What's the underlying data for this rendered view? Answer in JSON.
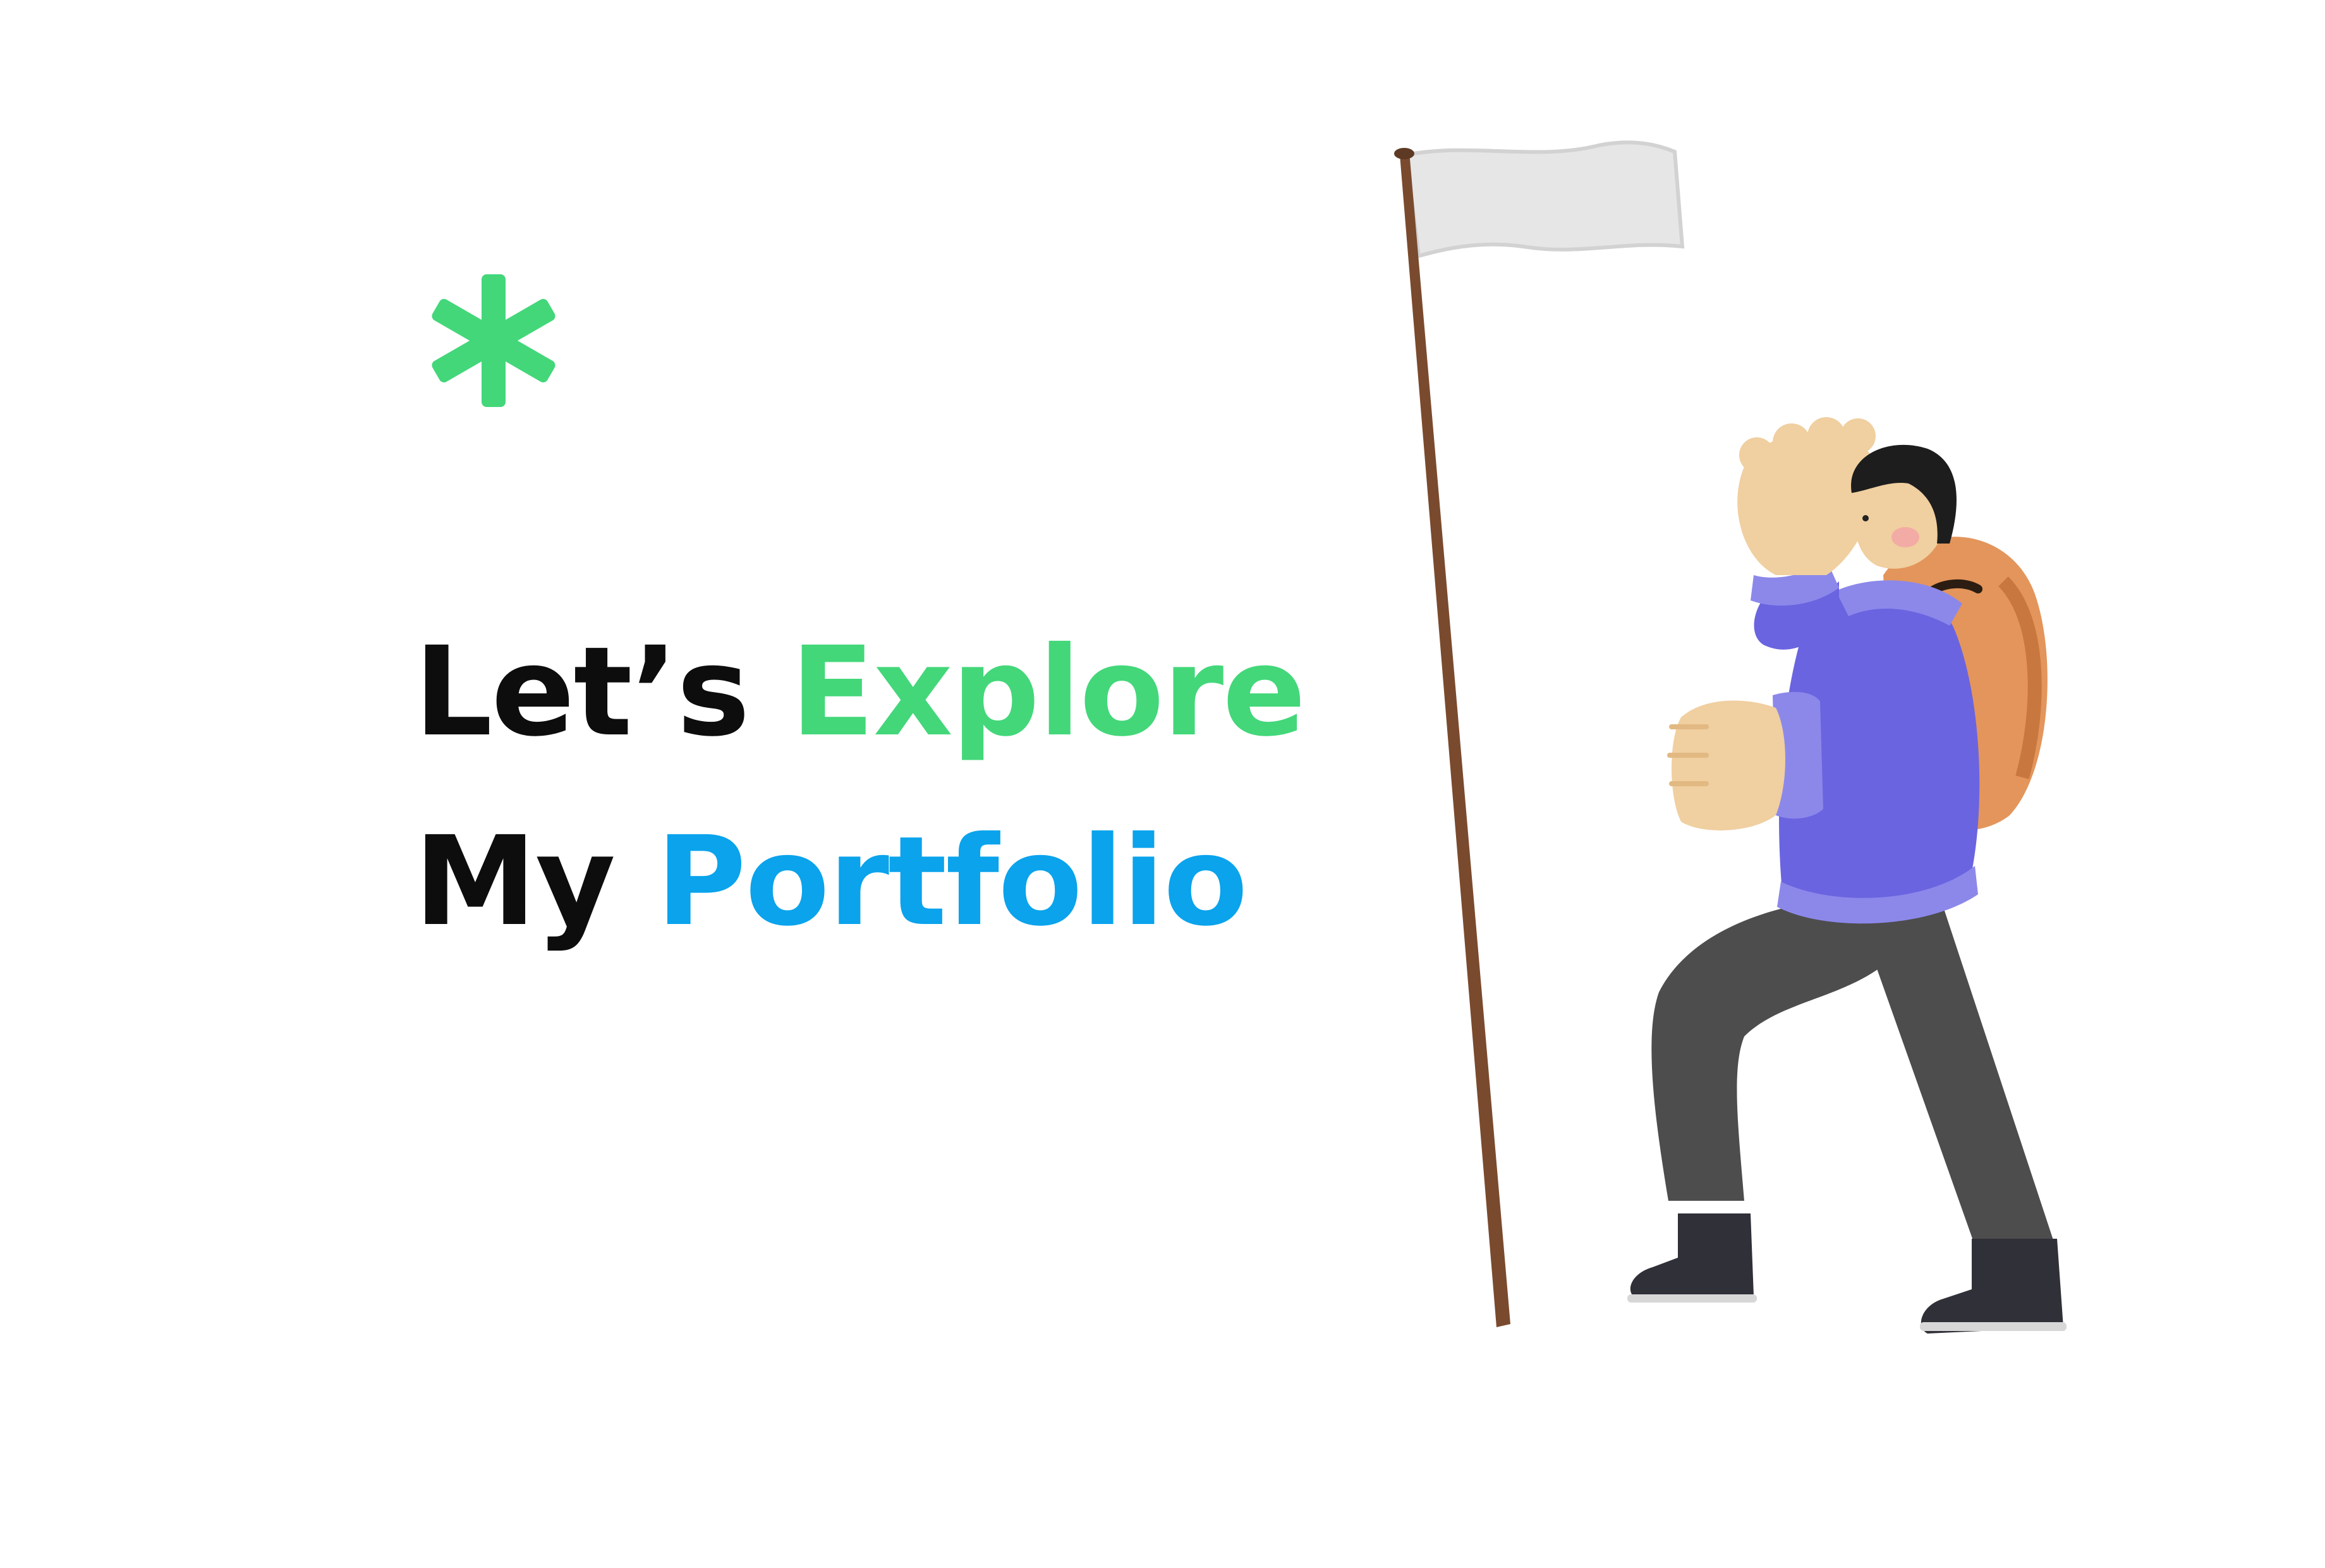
{
  "hero": {
    "line1_prefix": "Let’s",
    "line1_highlight": "Explore",
    "line2_prefix": "My",
    "line2_highlight": "Portfolio"
  },
  "decoration": {
    "asterisk_icon": "asterisk-icon",
    "illustration": "hiker-with-flag-illustration"
  },
  "colors": {
    "background": "#ffffff",
    "text_dark": "#0d0d0d",
    "accent_green": "#43d77a",
    "accent_blue": "#0aa3ec",
    "hoodie_purple": "#6a64e0",
    "backpack_orange": "#e3955b",
    "pants_gray": "#4b4b4b",
    "pole_brown": "#7a4a2e",
    "flag_white": "#e9e9e9"
  }
}
